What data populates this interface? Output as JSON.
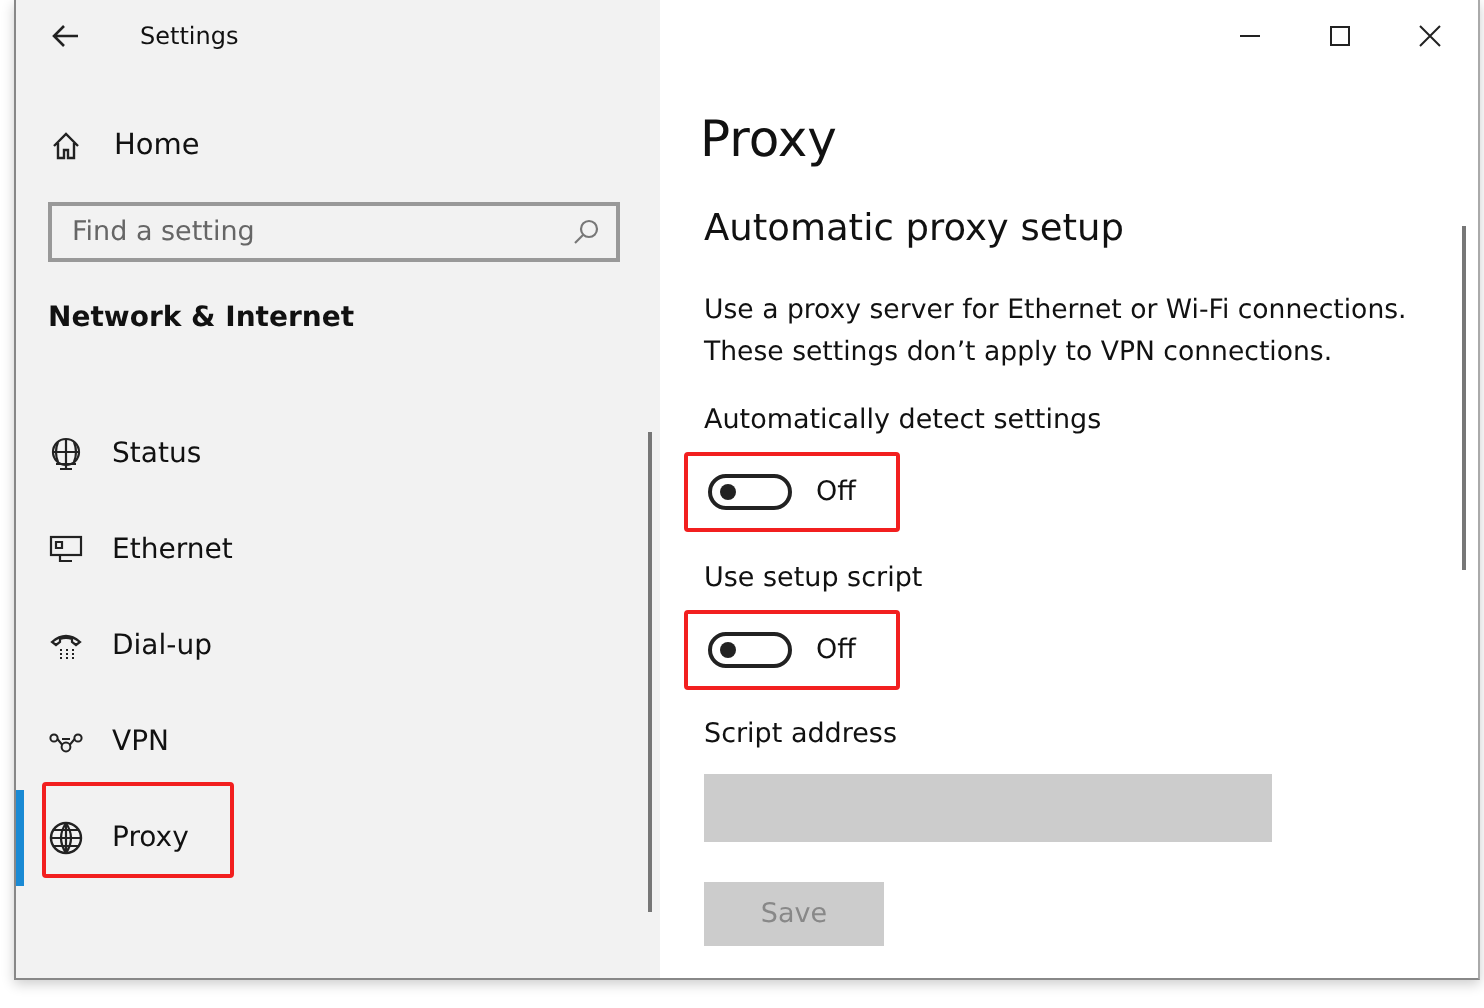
{
  "window": {
    "title": "Settings"
  },
  "sidebar": {
    "home": "Home",
    "search": {
      "placeholder": "Find a setting"
    },
    "section": "Network & Internet",
    "items": [
      {
        "label": "Status",
        "kind": "status",
        "selected": false,
        "highlighted": false
      },
      {
        "label": "Ethernet",
        "kind": "ethernet",
        "selected": false,
        "highlighted": false
      },
      {
        "label": "Dial-up",
        "kind": "dialup",
        "selected": false,
        "highlighted": false
      },
      {
        "label": "VPN",
        "kind": "vpn",
        "selected": false,
        "highlighted": false
      },
      {
        "label": "Proxy",
        "kind": "proxy",
        "selected": true,
        "highlighted": true
      }
    ]
  },
  "content": {
    "title": "Proxy",
    "section": "Automatic proxy setup",
    "description": "Use a proxy server for Ethernet or Wi-Fi connections. These settings don’t apply to VPN connections.",
    "toggles": [
      {
        "label": "Automatically detect settings",
        "on": false,
        "state_text": "Off",
        "highlighted": true
      },
      {
        "label": "Use setup script",
        "on": false,
        "state_text": "Off",
        "highlighted": true
      }
    ],
    "script_address": {
      "label": "Script address"
    },
    "save_button": {
      "label": "Save",
      "disabled": true
    }
  }
}
